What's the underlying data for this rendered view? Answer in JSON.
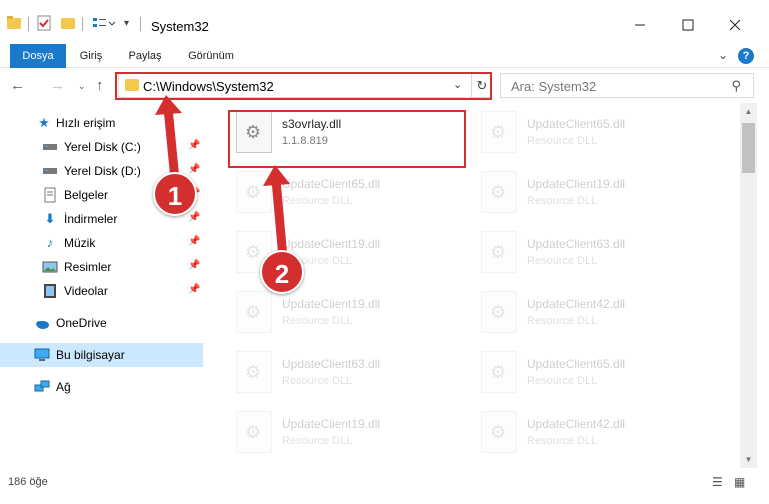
{
  "window": {
    "title": "System32"
  },
  "ribbon": {
    "tabs": [
      "Dosya",
      "Giriş",
      "Paylaş",
      "Görünüm"
    ],
    "help_label": "?"
  },
  "address": {
    "path": "C:\\Windows\\System32",
    "search_placeholder": "Ara: System32"
  },
  "sidebar": {
    "items": [
      {
        "label": "Hızlı erişim",
        "icon": "star-icon"
      },
      {
        "label": "Yerel Disk (C:)",
        "icon": "drive-icon",
        "pinned": true
      },
      {
        "label": "Yerel Disk (D:)",
        "icon": "drive-icon",
        "pinned": true
      },
      {
        "label": "Belgeler",
        "icon": "documents-icon",
        "pinned": true
      },
      {
        "label": "İndirmeler",
        "icon": "download-icon",
        "pinned": true
      },
      {
        "label": "Müzik",
        "icon": "music-icon",
        "pinned": true
      },
      {
        "label": "Resimler",
        "icon": "pictures-icon",
        "pinned": true
      },
      {
        "label": "Videolar",
        "icon": "video-icon",
        "pinned": true
      },
      {
        "label": "OneDrive",
        "icon": "cloud-icon"
      },
      {
        "label": "Bu bilgisayar",
        "icon": "computer-icon",
        "selected": true
      },
      {
        "label": "Ağ",
        "icon": "network-icon"
      }
    ]
  },
  "files": [
    {
      "name": "s3ovrlay.dll",
      "sub": "1.1.8.819",
      "highlighted": true
    },
    {
      "name": "UpdateClient65.dll",
      "sub": "Resource DLL"
    },
    {
      "name": "UpdateClient65.dll",
      "sub": "Resource DLL"
    },
    {
      "name": "UpdateClient19.dll",
      "sub": "Resource DLL"
    },
    {
      "name": "UpdateClient19.dll",
      "sub": "Resource DLL"
    },
    {
      "name": "UpdateClient63.dll",
      "sub": "Resource DLL"
    },
    {
      "name": "UpdateClient19.dll",
      "sub": "Resource DLL"
    },
    {
      "name": "UpdateClient42.dll",
      "sub": "Resource DLL"
    },
    {
      "name": "UpdateClient63.dll",
      "sub": "Resource DLL"
    },
    {
      "name": "UpdateClient65.dll",
      "sub": "Resource DLL"
    },
    {
      "name": "UpdateClient19.dll",
      "sub": "Resource DLL"
    },
    {
      "name": "UpdateClient42.dll",
      "sub": "Resource DLL"
    }
  ],
  "status": {
    "count": "186 öğe"
  },
  "annotations": {
    "badge1": "1",
    "badge2": "2",
    "color": "#d32f2f"
  },
  "colors": {
    "accent": "#1979ca",
    "selected": "#cce8ff"
  }
}
